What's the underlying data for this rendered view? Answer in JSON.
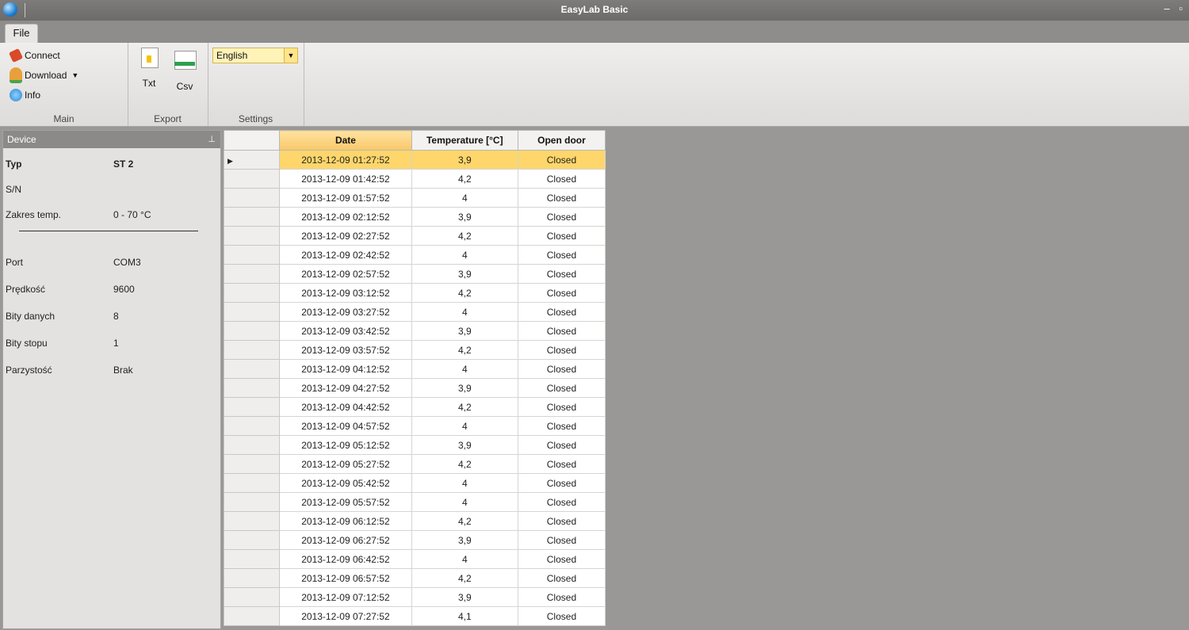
{
  "window": {
    "title": "EasyLab Basic",
    "controls": "– ▫"
  },
  "tabs": [
    {
      "label": "File"
    }
  ],
  "ribbon": {
    "main": {
      "label": "Main",
      "connect": "Connect",
      "download": "Download",
      "info": "Info"
    },
    "export": {
      "label": "Export",
      "txt": "Txt",
      "csv": "Csv"
    },
    "settings": {
      "label": "Settings",
      "language": "English"
    }
  },
  "device": {
    "header": "Device",
    "rows": [
      {
        "key": "Typ",
        "value": "ST 2"
      },
      {
        "key": "S/N",
        "value": ""
      },
      {
        "key": "Zakres temp.",
        "value": "0 - 70 °C"
      },
      {
        "key": "Port",
        "value": "COM3"
      },
      {
        "key": "Prędkość",
        "value": "9600"
      },
      {
        "key": "Bity danych",
        "value": "8"
      },
      {
        "key": "Bity stopu",
        "value": "1"
      },
      {
        "key": "Parzystość",
        "value": "Brak"
      }
    ]
  },
  "grid": {
    "current_row_marker": "▶",
    "columns": [
      "Date",
      "Temperature [°C]",
      "Open door"
    ],
    "rows": [
      [
        "2013-12-09 01:27:52",
        "3,9",
        "Closed"
      ],
      [
        "2013-12-09 01:42:52",
        "4,2",
        "Closed"
      ],
      [
        "2013-12-09 01:57:52",
        "4",
        "Closed"
      ],
      [
        "2013-12-09 02:12:52",
        "3,9",
        "Closed"
      ],
      [
        "2013-12-09 02:27:52",
        "4,2",
        "Closed"
      ],
      [
        "2013-12-09 02:42:52",
        "4",
        "Closed"
      ],
      [
        "2013-12-09 02:57:52",
        "3,9",
        "Closed"
      ],
      [
        "2013-12-09 03:12:52",
        "4,2",
        "Closed"
      ],
      [
        "2013-12-09 03:27:52",
        "4",
        "Closed"
      ],
      [
        "2013-12-09 03:42:52",
        "3,9",
        "Closed"
      ],
      [
        "2013-12-09 03:57:52",
        "4,2",
        "Closed"
      ],
      [
        "2013-12-09 04:12:52",
        "4",
        "Closed"
      ],
      [
        "2013-12-09 04:27:52",
        "3,9",
        "Closed"
      ],
      [
        "2013-12-09 04:42:52",
        "4,2",
        "Closed"
      ],
      [
        "2013-12-09 04:57:52",
        "4",
        "Closed"
      ],
      [
        "2013-12-09 05:12:52",
        "3,9",
        "Closed"
      ],
      [
        "2013-12-09 05:27:52",
        "4,2",
        "Closed"
      ],
      [
        "2013-12-09 05:42:52",
        "4",
        "Closed"
      ],
      [
        "2013-12-09 05:57:52",
        "4",
        "Closed"
      ],
      [
        "2013-12-09 06:12:52",
        "4,2",
        "Closed"
      ],
      [
        "2013-12-09 06:27:52",
        "3,9",
        "Closed"
      ],
      [
        "2013-12-09 06:42:52",
        "4",
        "Closed"
      ],
      [
        "2013-12-09 06:57:52",
        "4,2",
        "Closed"
      ],
      [
        "2013-12-09 07:12:52",
        "3,9",
        "Closed"
      ],
      [
        "2013-12-09 07:27:52",
        "4,1",
        "Closed"
      ]
    ]
  }
}
